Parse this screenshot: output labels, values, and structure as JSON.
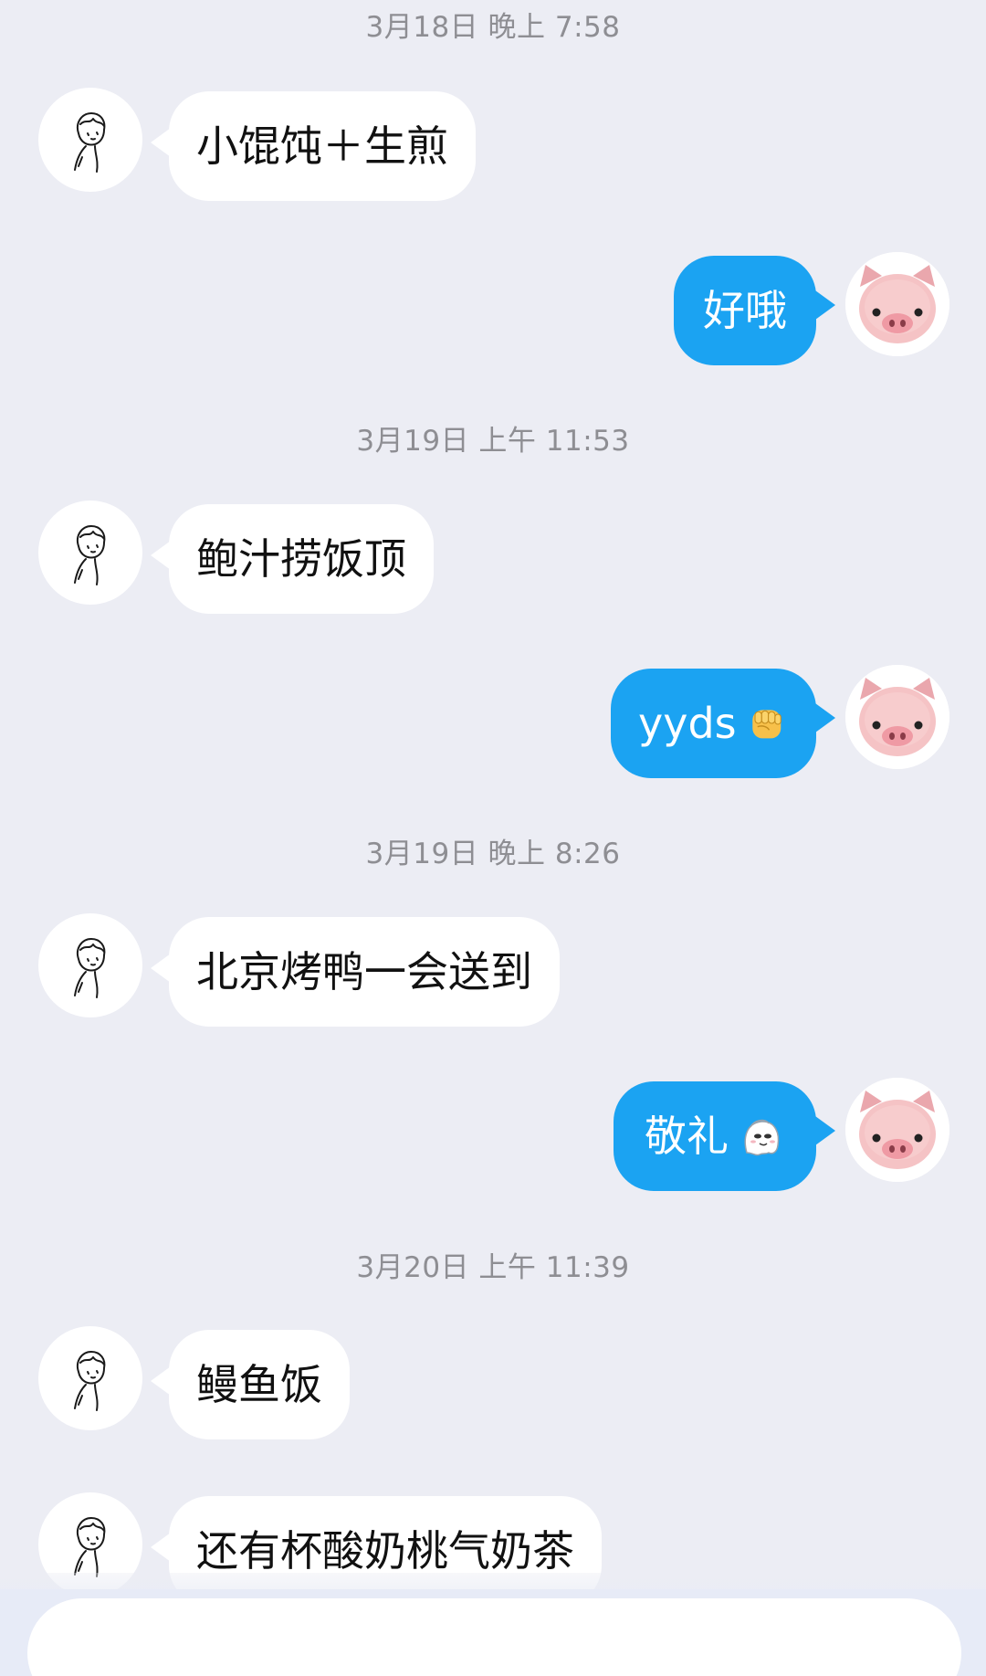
{
  "timestamps": [
    "3月18日 晚上 7:58",
    "3月19日 上午 11:53",
    "3月19日 晚上 8:26",
    "3月20日 上午 11:39"
  ],
  "messages": [
    {
      "sender": "contact",
      "text": "小馄饨＋生煎"
    },
    {
      "sender": "me",
      "text": "好哦"
    },
    {
      "sender": "contact",
      "text": "鲍汁捞饭顶"
    },
    {
      "sender": "me",
      "text": "yyds",
      "emoji": "fist-emoji"
    },
    {
      "sender": "contact",
      "text": "北京烤鸭一会送到"
    },
    {
      "sender": "me",
      "text": "敬礼",
      "emoji": "salute-ghost-emoji"
    },
    {
      "sender": "contact",
      "text": "鳗鱼饭"
    },
    {
      "sender": "contact",
      "text": "还有杯酸奶桃气奶茶"
    }
  ],
  "avatars": {
    "contact": "line-drawing-boy-avatar",
    "me": "pink-pig-avatar"
  },
  "input": {
    "value": "",
    "placeholder": ""
  },
  "colors": {
    "background": "#ecedf4",
    "outgoing_bubble": "#1ba3f2",
    "incoming_bubble": "#ffffff",
    "timestamp": "#8e8e93"
  }
}
